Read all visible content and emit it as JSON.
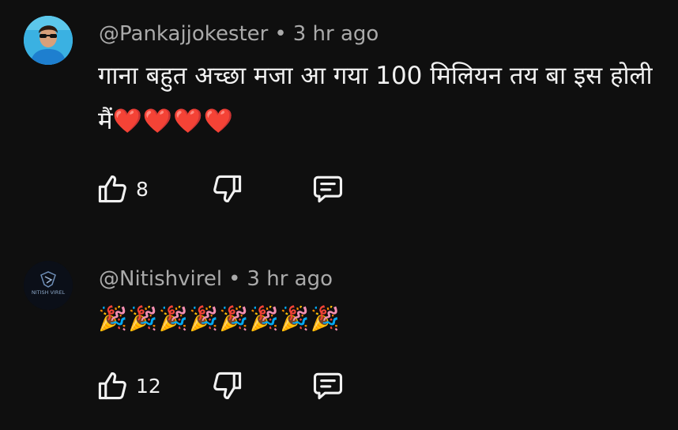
{
  "colors": {
    "background": "#0f0f0f",
    "text": "#f1f1f1",
    "meta": "#aaaaaa",
    "heart": "#e1252c"
  },
  "comments": [
    {
      "author": "@Pankajjokester",
      "separator": "•",
      "time": "3 hr ago",
      "text": "गाना बहुत अच्छा मजा आ गया 100 मिलियन तय बा इस होली मैं",
      "emoji": "❤️❤️❤️❤️",
      "likes": "8",
      "icons": [
        "thumbs-up-icon",
        "thumbs-down-icon",
        "reply-icon"
      ]
    },
    {
      "author": "@Nitishvirel",
      "separator": "•",
      "time": "3 hr ago",
      "text": "",
      "emoji": "🎉🎉🎉🎉🎉🎉🎉🎉",
      "likes": "12",
      "avatar_text": "NITISH VIREL",
      "icons": [
        "thumbs-up-icon",
        "thumbs-down-icon",
        "reply-icon"
      ]
    }
  ]
}
